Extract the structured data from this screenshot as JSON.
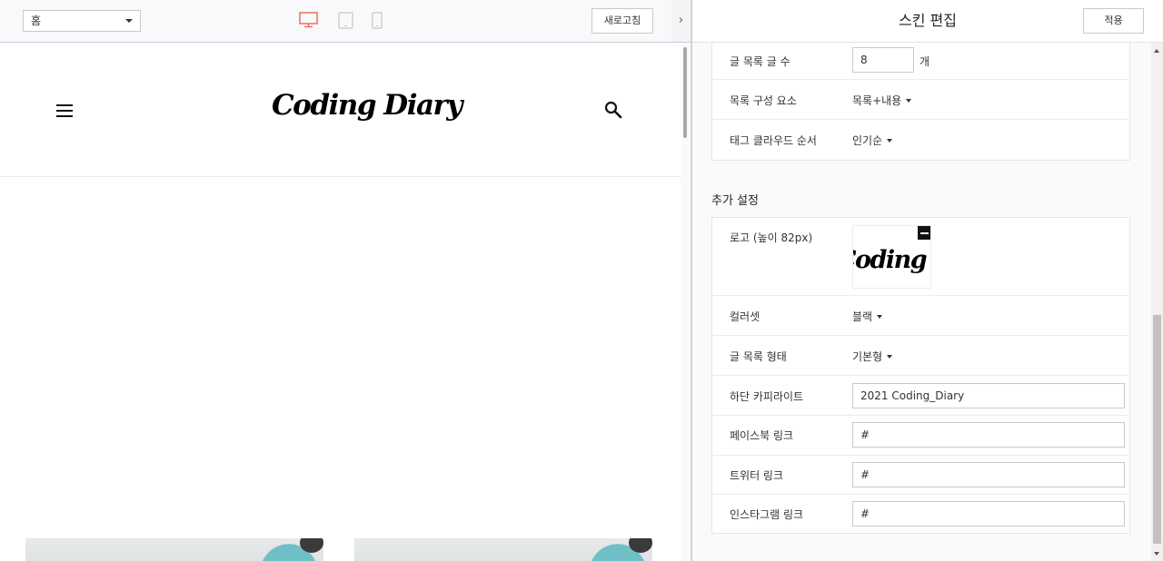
{
  "toolbar": {
    "page_select": "홈",
    "refresh_label": "새로고침",
    "collapse_glyph": "›",
    "active_device_color": "#f26d5b"
  },
  "preview": {
    "logo_text": "Coding Diary"
  },
  "editor": {
    "title": "스킨 편집",
    "apply_label": "적용",
    "list_settings": {
      "post_count_label": "글 목록 글 수",
      "post_count_value": "8",
      "post_count_unit": "개",
      "components_label": "목록 구성 요소",
      "components_value": "목록+내용",
      "tag_order_label": "태그 클라우드 순서",
      "tag_order_value": "인기순"
    },
    "extra": {
      "section_title": "추가 설정",
      "logo_label": "로고 (높이 82px)",
      "logo_preview_text": "Coding Diary",
      "colorset_label": "컬러셋",
      "colorset_value": "블랙",
      "list_type_label": "글 목록 형태",
      "list_type_value": "기본형",
      "copyright_label": "하단 카피라이트",
      "copyright_value": "2021 Coding_Diary",
      "facebook_label": "페이스북 링크",
      "facebook_value": "#",
      "twitter_label": "트위터 링크",
      "twitter_value": "#",
      "instagram_label": "인스타그램 링크",
      "instagram_value": "#"
    }
  }
}
